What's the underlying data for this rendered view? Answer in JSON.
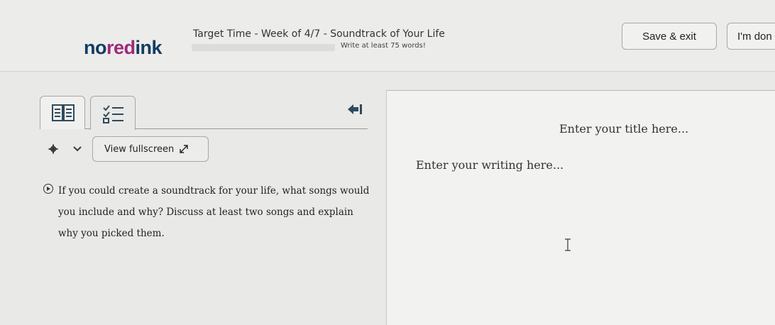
{
  "header": {
    "logo": {
      "part1": "no",
      "part2": "red",
      "part3": "ink"
    },
    "title": "Target Time - Week of 4/7 - Soundtrack of Your Life",
    "word_goal_label": "Write at least 75 words!",
    "word_progress": 0,
    "save_label": "Save & exit",
    "done_label": "I'm don"
  },
  "tabs": [
    {
      "icon": "book-icon"
    },
    {
      "icon": "checklist-icon"
    }
  ],
  "toolbar": {
    "settings_icon": "gear-icon",
    "fullscreen_label": "View fullscreen",
    "fullscreen_icon": "expand-arrow-icon"
  },
  "prompt": {
    "text": "If you could create a soundtrack for your life, what songs would you include and why? Discuss at least two songs and explain why you picked them."
  },
  "editor": {
    "title_placeholder": "Enter your title here...",
    "body_placeholder": "Enter your writing here..."
  },
  "colors": {
    "logo_primary": "#123c63",
    "logo_accent": "#9e2a7a"
  }
}
